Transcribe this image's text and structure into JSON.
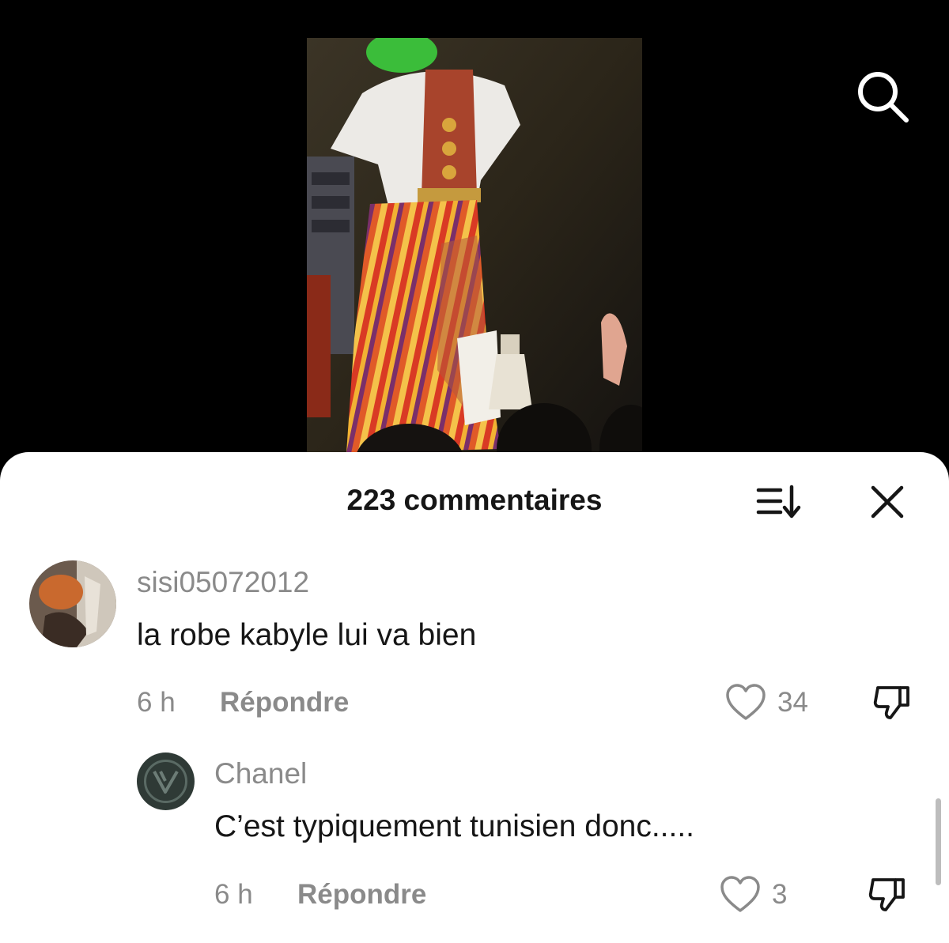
{
  "header": {
    "search_icon": "search-icon"
  },
  "video": {
    "thumbnail_icon": "video-thumbnail"
  },
  "comments_sheet": {
    "title": "223 commentaires",
    "sort_icon": "sort-icon",
    "close_icon": "close-icon"
  },
  "comments": [
    {
      "username": "sisi05072012",
      "text": "la robe kabyle lui va bien",
      "time": "6 h",
      "reply_label": "Répondre",
      "likes": "34"
    },
    {
      "username": "Chanel",
      "text": "C’est typiquement tunisien donc.....",
      "time": "6 h",
      "reply_label": "Répondre",
      "likes": "3"
    }
  ],
  "colors": {
    "text_primary": "#161616",
    "text_secondary": "#8a8a8a",
    "sheet_background": "#ffffff",
    "video_background": "#000000"
  }
}
